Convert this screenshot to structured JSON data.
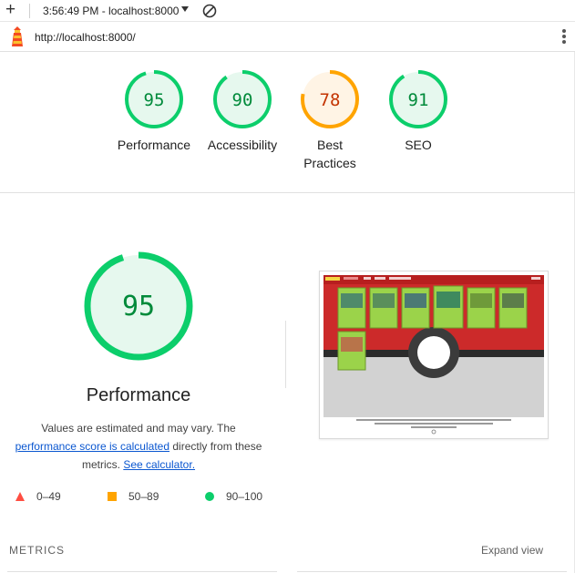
{
  "toolbar": {
    "time_host": "3:56:49 PM - localhost:8000"
  },
  "urlbar": {
    "url": "http://localhost:8000/"
  },
  "scores": [
    {
      "label": "Performance",
      "score": 95,
      "color": "#0cce6b",
      "fill": "#e6f8ee",
      "text_color": "#008a3a"
    },
    {
      "label": "Accessibility",
      "score": 90,
      "color": "#0cce6b",
      "fill": "#e6f8ee",
      "text_color": "#008a3a"
    },
    {
      "label": "Best Practices",
      "score": 78,
      "color": "#ffa400",
      "fill": "#fff4e5",
      "text_color": "#c33300"
    },
    {
      "label": "SEO",
      "score": 91,
      "color": "#0cce6b",
      "fill": "#e6f8ee",
      "text_color": "#008a3a"
    }
  ],
  "performance": {
    "score": 95,
    "title": "Performance",
    "desc_prefix": "Values are estimated and may vary. The",
    "link_score": "performance score is calculated",
    "desc_mid": "directly from these",
    "desc_metrics": "metrics.",
    "link_calc": "See calculator."
  },
  "legend": {
    "fail": "0–49",
    "average": "50–89",
    "pass": "90–100"
  },
  "metrics": {
    "heading": "METRICS",
    "expand": "Expand view"
  },
  "colors": {
    "pass": "#0cce6b",
    "average": "#ffa400",
    "fail": "#ff4e42"
  }
}
